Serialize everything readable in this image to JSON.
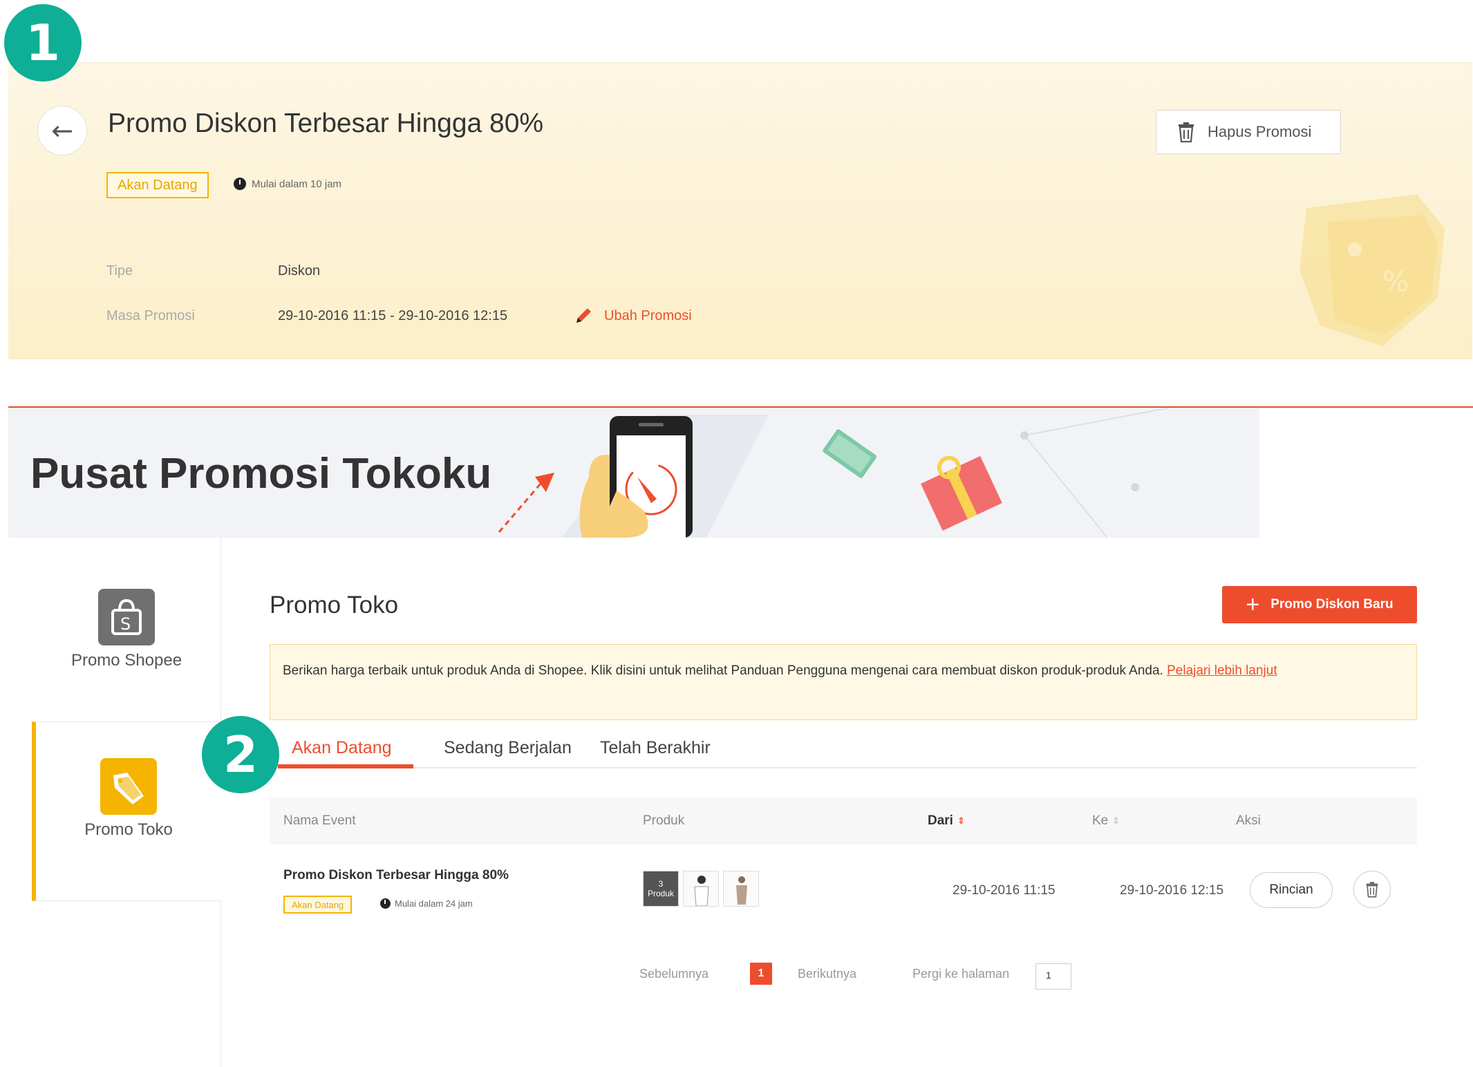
{
  "steps": {
    "one": "1",
    "two": "2"
  },
  "detail": {
    "title": "Promo Diskon Terbesar Hingga 80%",
    "delete_label": "Hapus Promosi",
    "status": "Akan Datang",
    "countdown": "Mulai dalam 10 jam",
    "type_label": "Tipe",
    "type_value": "Diskon",
    "period_label": "Masa Promosi",
    "period_value": "29-10-2016 11:15 - 29-10-2016 12:15",
    "edit_label": "Ubah Promosi"
  },
  "banner": {
    "title": "Pusat Promosi Tokoku"
  },
  "sidebar": {
    "items": [
      {
        "label": "Promo Shopee",
        "icon": "shopee-bag-icon"
      },
      {
        "label": "Promo Toko",
        "icon": "shop-tag-icon"
      }
    ]
  },
  "main": {
    "heading": "Promo Toko",
    "new_button": "Promo Diskon Baru",
    "info_text": "Berikan harga terbaik untuk produk Anda di Shopee. Klik disini untuk melihat Panduan Pengguna mengenai cara membuat diskon produk-produk Anda. ",
    "info_link": "Pelajari lebih lanjut",
    "tabs": [
      "Akan Datang",
      "Sedang Berjalan",
      "Telah Berakhir"
    ],
    "columns": [
      "Nama Event",
      "Produk",
      "Dari",
      "Ke",
      "Aksi"
    ],
    "rows": [
      {
        "name": "Promo Diskon Terbesar Hingga 80%",
        "status": "Akan Datang",
        "countdown": "Mulai dalam 24 jam",
        "product_count": "3",
        "product_label": "Produk",
        "from": "29-10-2016 11:15",
        "to": "29-10-2016 12:15",
        "detail_label": "Rincian"
      }
    ],
    "pagination": {
      "prev": "Sebelumnya",
      "current": "1",
      "next": "Berikutnya",
      "goto_label": "Pergi ke halaman",
      "goto_value": "1"
    }
  },
  "colors": {
    "accent": "#ee4d2d",
    "yellow": "#f5b400",
    "step": "#0fae96"
  }
}
